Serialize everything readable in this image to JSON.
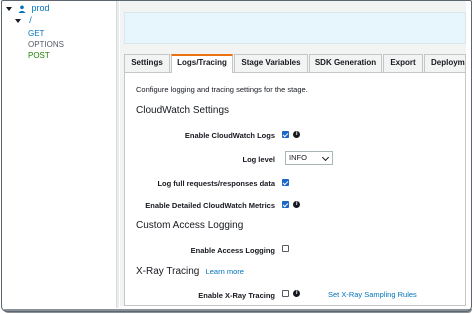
{
  "tree": {
    "stage": "prod",
    "resource": "/",
    "methods": [
      "GET",
      "OPTIONS",
      "POST"
    ]
  },
  "tabs": [
    "Settings",
    "Logs/Tracing",
    "Stage Variables",
    "SDK Generation",
    "Export",
    "Deploym"
  ],
  "active_tab_index": 1,
  "panel": {
    "intro": "Configure logging and tracing settings for the stage.",
    "cloudwatch": {
      "heading": "CloudWatch Settings",
      "enable_logs_label": "Enable CloudWatch Logs",
      "enable_logs_checked": true,
      "log_level_label": "Log level",
      "log_level_value": "INFO",
      "log_full_label": "Log full requests/responses data",
      "log_full_checked": true,
      "detailed_metrics_label": "Enable Detailed CloudWatch Metrics",
      "detailed_metrics_checked": true
    },
    "custom_access": {
      "heading": "Custom Access Logging",
      "enable_label": "Enable Access Logging",
      "enable_checked": false
    },
    "xray": {
      "heading": "X-Ray Tracing",
      "learn_more": "Learn more",
      "enable_label": "Enable X-Ray Tracing",
      "enable_checked": false,
      "sampling_link": "Set X-Ray Sampling Rules"
    }
  },
  "icons": {
    "info": "i"
  },
  "colors": {
    "accent_tab": "#ec7211",
    "link": "#0073bb",
    "checkbox": "#1a66c9",
    "banner": "#e7f6fd",
    "post": "#1d8102"
  }
}
